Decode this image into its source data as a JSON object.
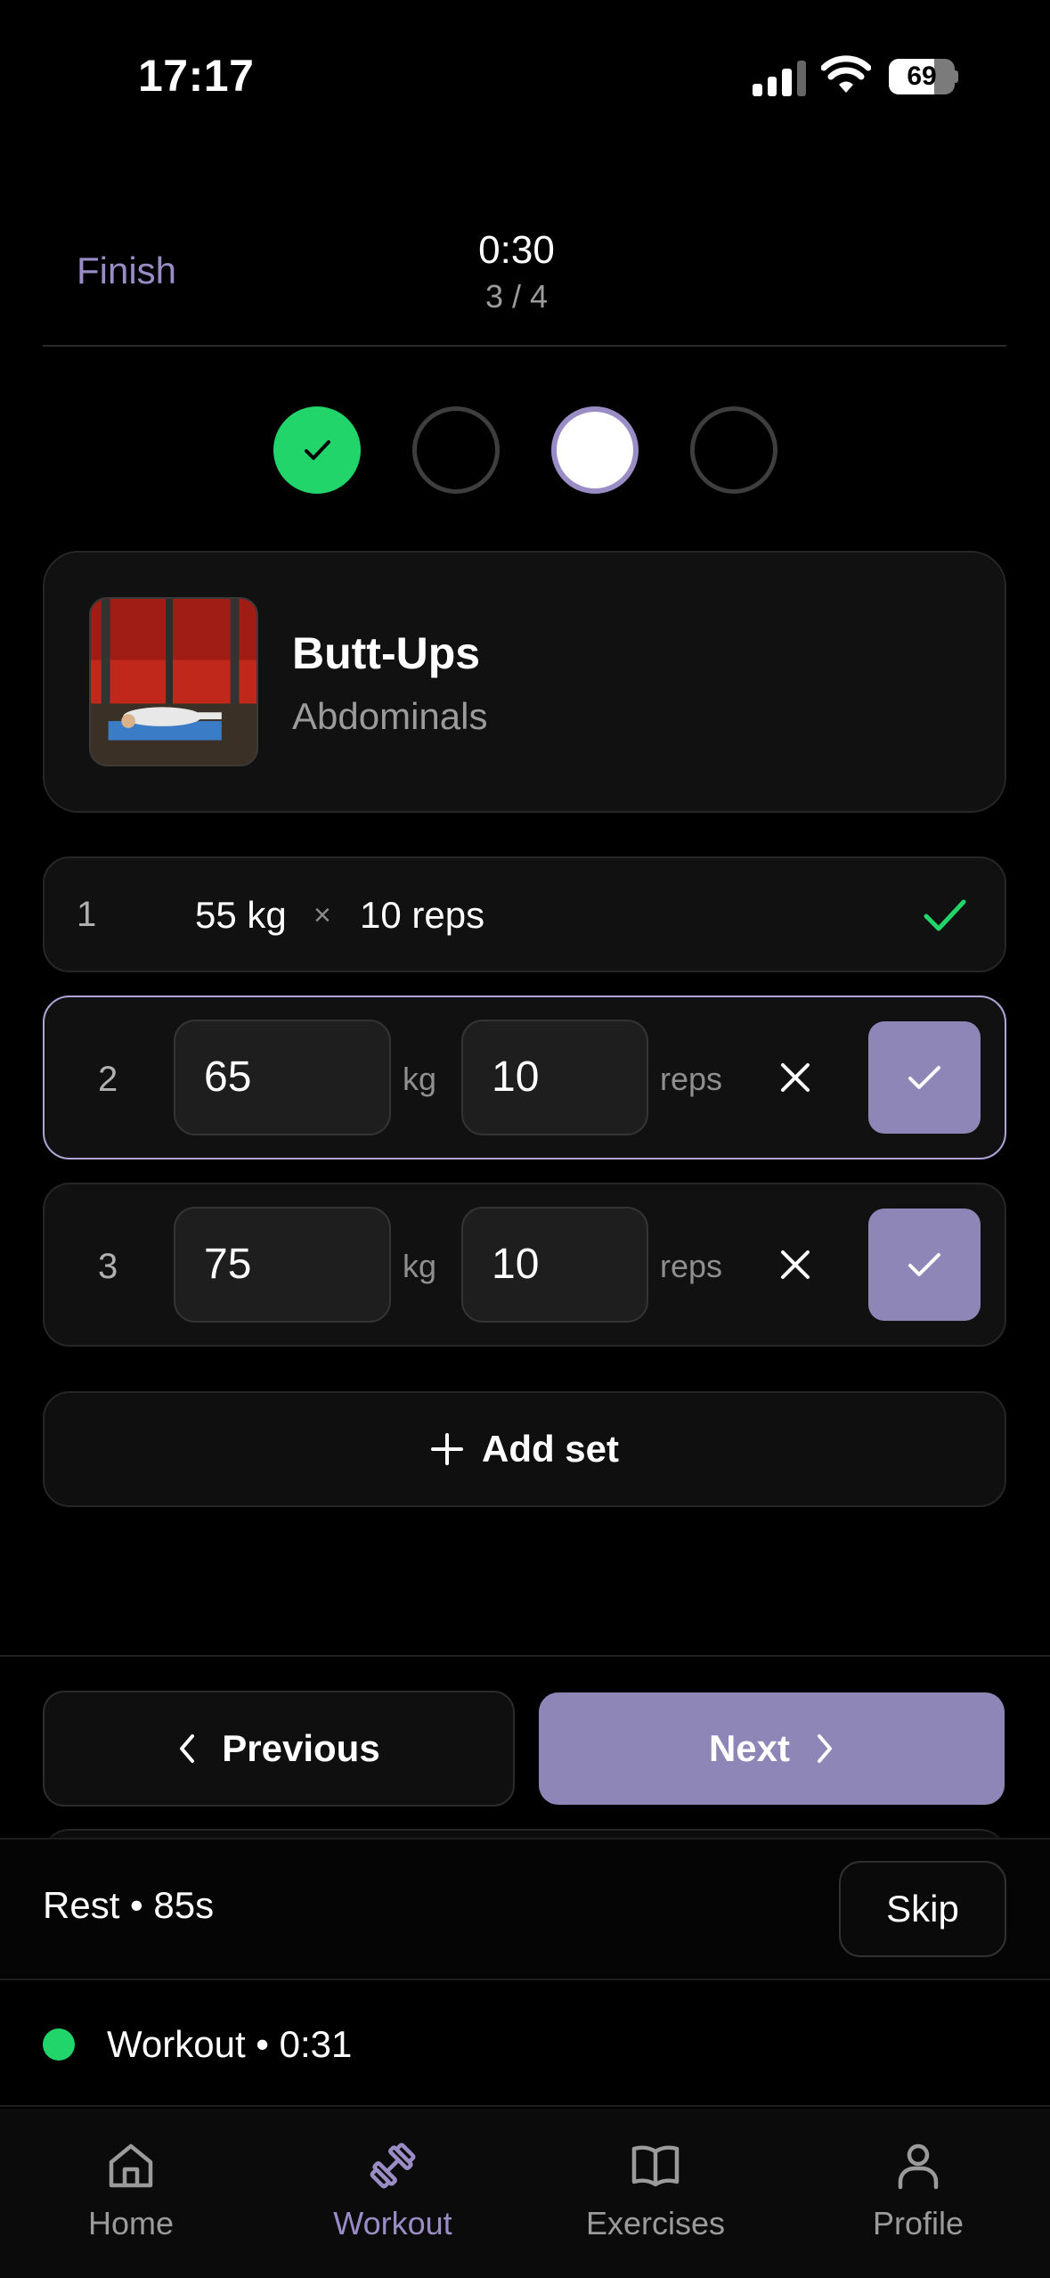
{
  "status_bar": {
    "time": "17:17",
    "battery": "69",
    "battery_level": 0.69
  },
  "header": {
    "finish_label": "Finish",
    "timer": "0:30",
    "progress": "3 / 4"
  },
  "steps": [
    "done",
    "open",
    "current",
    "open"
  ],
  "exercise": {
    "name": "Butt-Ups",
    "muscle": "Abdominals"
  },
  "sets": [
    {
      "number": "1",
      "weight": "55 kg",
      "separator": "×",
      "reps": "10 reps",
      "completed": true
    },
    {
      "number": "2",
      "weight": "65",
      "weight_unit": "kg",
      "reps": "10",
      "reps_unit": "reps",
      "completed": false
    },
    {
      "number": "3",
      "weight": "75",
      "weight_unit": "kg",
      "reps": "10",
      "reps_unit": "reps",
      "completed": false
    }
  ],
  "add_set_label": "Add set",
  "navigation": {
    "previous_label": "Previous",
    "next_label": "Next"
  },
  "rest": {
    "label": "Rest • 85s",
    "skip_label": "Skip"
  },
  "workout_status": "Workout • 0:31",
  "tabs": [
    {
      "label": "Home",
      "icon": "home-icon"
    },
    {
      "label": "Workout",
      "icon": "dumbbell-icon",
      "active": true
    },
    {
      "label": "Exercises",
      "icon": "book-icon"
    },
    {
      "label": "Profile",
      "icon": "user-icon"
    }
  ],
  "colors": {
    "accent": "#8f86b8",
    "accent_text": "#9a8cc4",
    "success": "#22d56b",
    "background": "#000000",
    "card": "#111111"
  }
}
